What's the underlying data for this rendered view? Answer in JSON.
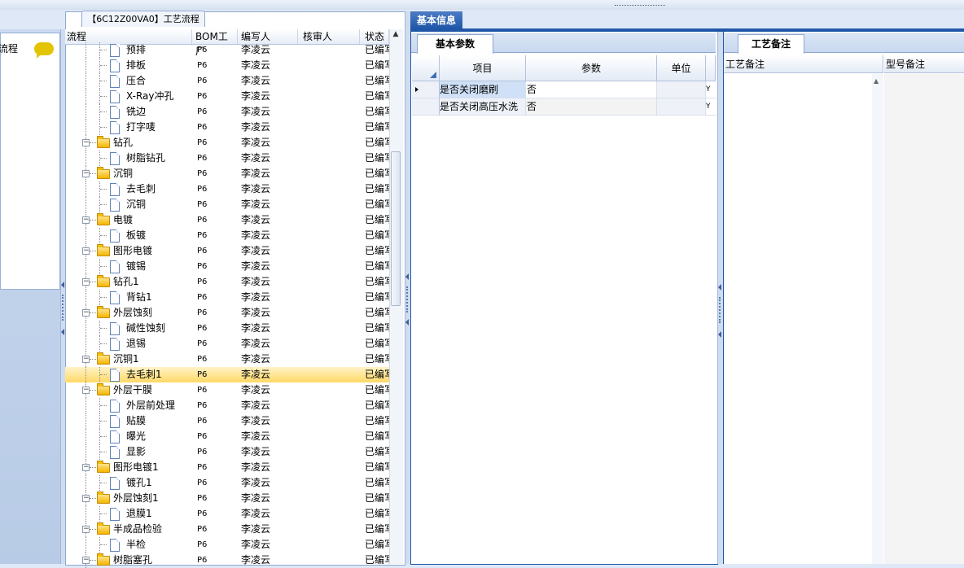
{
  "tree_panel": {
    "tab_title": "【6C12Z00VA0】工艺流程",
    "columns": [
      "流程",
      "BOM工厂",
      "编写人",
      "核审人",
      "状态"
    ],
    "rows": [
      {
        "label": "预排",
        "kind": "doc",
        "bom": "P6",
        "writer": "李凌云",
        "reviewer": "",
        "status": "已编写"
      },
      {
        "label": "排板",
        "kind": "doc",
        "bom": "P6",
        "writer": "李凌云",
        "reviewer": "",
        "status": "已编写"
      },
      {
        "label": "压合",
        "kind": "doc",
        "bom": "P6",
        "writer": "李凌云",
        "reviewer": "",
        "status": "已编写"
      },
      {
        "label": "X-Ray冲孔",
        "kind": "doc",
        "bom": "P6",
        "writer": "李凌云",
        "reviewer": "",
        "status": "已编写"
      },
      {
        "label": "铣边",
        "kind": "doc",
        "bom": "P6",
        "writer": "李凌云",
        "reviewer": "",
        "status": "已编写"
      },
      {
        "label": "打字唛",
        "kind": "doc",
        "bom": "P6",
        "writer": "李凌云",
        "reviewer": "",
        "status": "已编写"
      },
      {
        "label": "钻孔",
        "kind": "folder",
        "bom": "P6",
        "writer": "李凌云",
        "reviewer": "",
        "status": "已编写"
      },
      {
        "label": "树脂钻孔",
        "kind": "doc",
        "bom": "P6",
        "writer": "李凌云",
        "reviewer": "",
        "status": "已编写"
      },
      {
        "label": "沉铜",
        "kind": "folder",
        "bom": "P6",
        "writer": "李凌云",
        "reviewer": "",
        "status": "已编写"
      },
      {
        "label": "去毛刺",
        "kind": "doc",
        "bom": "P6",
        "writer": "李凌云",
        "reviewer": "",
        "status": "已编写"
      },
      {
        "label": "沉铜",
        "kind": "doc",
        "bom": "P6",
        "writer": "李凌云",
        "reviewer": "",
        "status": "已编写"
      },
      {
        "label": "电镀",
        "kind": "folder",
        "bom": "P6",
        "writer": "李凌云",
        "reviewer": "",
        "status": "已编写"
      },
      {
        "label": "板镀",
        "kind": "doc",
        "bom": "P6",
        "writer": "李凌云",
        "reviewer": "",
        "status": "已编写"
      },
      {
        "label": "图形电镀",
        "kind": "folder",
        "bom": "P6",
        "writer": "李凌云",
        "reviewer": "",
        "status": "已编写"
      },
      {
        "label": "镀锡",
        "kind": "doc",
        "bom": "P6",
        "writer": "李凌云",
        "reviewer": "",
        "status": "已编写"
      },
      {
        "label": "钻孔1",
        "kind": "folder",
        "bom": "P6",
        "writer": "李凌云",
        "reviewer": "",
        "status": "已编写"
      },
      {
        "label": "背钻1",
        "kind": "doc",
        "bom": "P6",
        "writer": "李凌云",
        "reviewer": "",
        "status": "已编写"
      },
      {
        "label": "外层蚀刻",
        "kind": "folder",
        "bom": "P6",
        "writer": "李凌云",
        "reviewer": "",
        "status": "已编写"
      },
      {
        "label": "碱性蚀刻",
        "kind": "doc",
        "bom": "P6",
        "writer": "李凌云",
        "reviewer": "",
        "status": "已编写"
      },
      {
        "label": "退锡",
        "kind": "doc",
        "bom": "P6",
        "writer": "李凌云",
        "reviewer": "",
        "status": "已编写"
      },
      {
        "label": "沉铜1",
        "kind": "folder",
        "bom": "P6",
        "writer": "李凌云",
        "reviewer": "",
        "status": "已编写"
      },
      {
        "label": "去毛刺1",
        "kind": "doc",
        "bom": "P6",
        "writer": "李凌云",
        "reviewer": "",
        "status": "已编写",
        "selected": true
      },
      {
        "label": "外层干膜",
        "kind": "folder",
        "bom": "P6",
        "writer": "李凌云",
        "reviewer": "",
        "status": "已编写"
      },
      {
        "label": "外层前处理",
        "kind": "doc",
        "bom": "P6",
        "writer": "李凌云",
        "reviewer": "",
        "status": "已编写"
      },
      {
        "label": "贴膜",
        "kind": "doc",
        "bom": "P6",
        "writer": "李凌云",
        "reviewer": "",
        "status": "已编写"
      },
      {
        "label": "曝光",
        "kind": "doc",
        "bom": "P6",
        "writer": "李凌云",
        "reviewer": "",
        "status": "已编写"
      },
      {
        "label": "显影",
        "kind": "doc",
        "bom": "P6",
        "writer": "李凌云",
        "reviewer": "",
        "status": "已编写"
      },
      {
        "label": "图形电镀1",
        "kind": "folder",
        "bom": "P6",
        "writer": "李凌云",
        "reviewer": "",
        "status": "已编写"
      },
      {
        "label": "镀孔1",
        "kind": "doc",
        "bom": "P6",
        "writer": "李凌云",
        "reviewer": "",
        "status": "已编写"
      },
      {
        "label": "外层蚀刻1",
        "kind": "folder",
        "bom": "P6",
        "writer": "李凌云",
        "reviewer": "",
        "status": "已编写"
      },
      {
        "label": "退膜1",
        "kind": "doc",
        "bom": "P6",
        "writer": "李凌云",
        "reviewer": "",
        "status": "已编写"
      },
      {
        "label": "半成品检验",
        "kind": "folder",
        "bom": "P6",
        "writer": "李凌云",
        "reviewer": "",
        "status": "已编写"
      },
      {
        "label": "半检",
        "kind": "doc",
        "bom": "P6",
        "writer": "李凌云",
        "reviewer": "",
        "status": "已编写"
      },
      {
        "label": "树脂塞孔",
        "kind": "folder",
        "bom": "P6",
        "writer": "李凌云",
        "reviewer": "",
        "status": "已编写"
      }
    ]
  },
  "left_panel": {
    "title": "流程"
  },
  "basic_info": {
    "tab_label": "基本信息",
    "params_tab_label": "基本参数",
    "columns": [
      "项目",
      "参数",
      "单位"
    ],
    "rows": [
      {
        "item": "是否关闭磨刷",
        "value": "否",
        "unit": "",
        "flag": "Y"
      },
      {
        "item": "是否关闭高压水洗",
        "value": "否",
        "unit": "",
        "flag": "Y"
      }
    ]
  },
  "notes": {
    "tab_label": "工艺备注",
    "columns": [
      "工艺备注",
      "型号备注"
    ]
  },
  "colors": {
    "accent": "#1f56a8",
    "selection": "#ffd966",
    "grid_line": "#b3c2db"
  }
}
